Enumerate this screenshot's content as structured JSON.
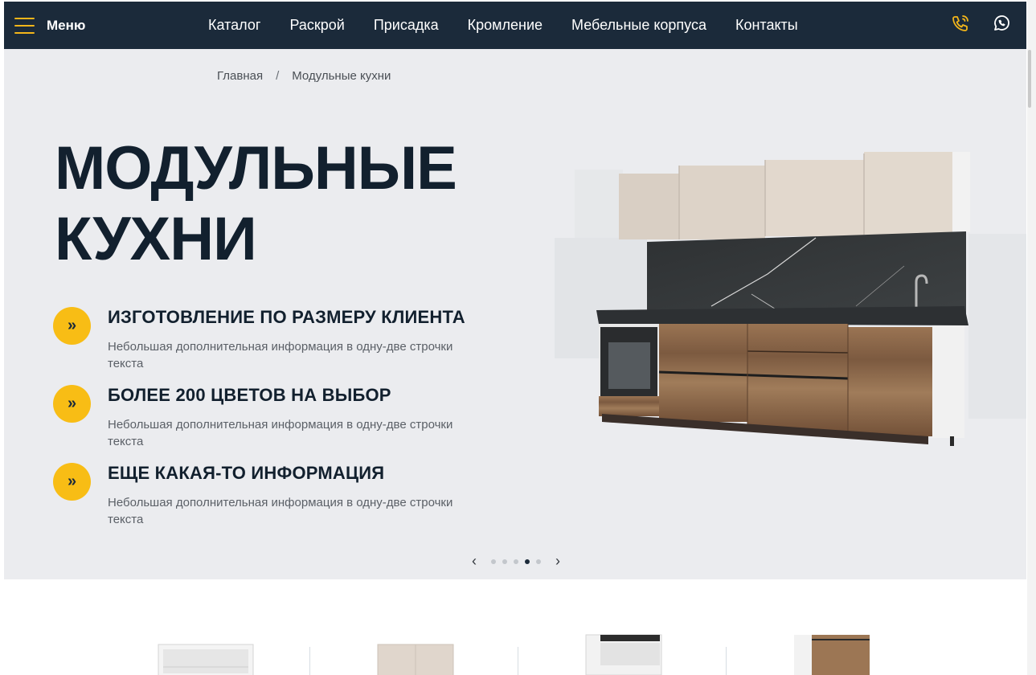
{
  "header": {
    "menu_label": "Меню",
    "nav": [
      "Каталог",
      "Раскрой",
      "Присадка",
      "Кромление",
      "Мебельные корпуса",
      "Контакты"
    ],
    "icons": [
      "phone-icon",
      "whatsapp-icon"
    ],
    "accent_color": "#f4b61a",
    "bg_color": "#1b2a3a"
  },
  "breadcrumb": {
    "home": "Главная",
    "separator": "/",
    "current": "Модульные кухни"
  },
  "hero": {
    "title_line1": "МОДУЛЬНЫЕ",
    "title_line2": "КУХНИ",
    "features": [
      {
        "title": "ИЗГОТОВЛЕНИЕ ПО РАЗМЕРУ КЛИЕНТА",
        "desc": "Небольшая дополнительная информация в одну-две строчки текста"
      },
      {
        "title": "БОЛЕЕ 200 ЦВЕТОВ НА ВЫБОР",
        "desc": "Небольшая дополнительная информация в одну-две строчки текста"
      },
      {
        "title": "ЕЩЕ КАКАЯ-ТО ИНФОРМАЦИЯ",
        "desc": "Небольшая дополнительная информация в одну-две строчки текста"
      }
    ],
    "bullet_glyph": "»",
    "slider": {
      "prev": "‹",
      "next": "›",
      "dots": 5,
      "active_index": 3
    }
  },
  "colors": {
    "bullet": "#f8bd15",
    "hero_bg": "#ebecef",
    "title": "#12202e"
  }
}
